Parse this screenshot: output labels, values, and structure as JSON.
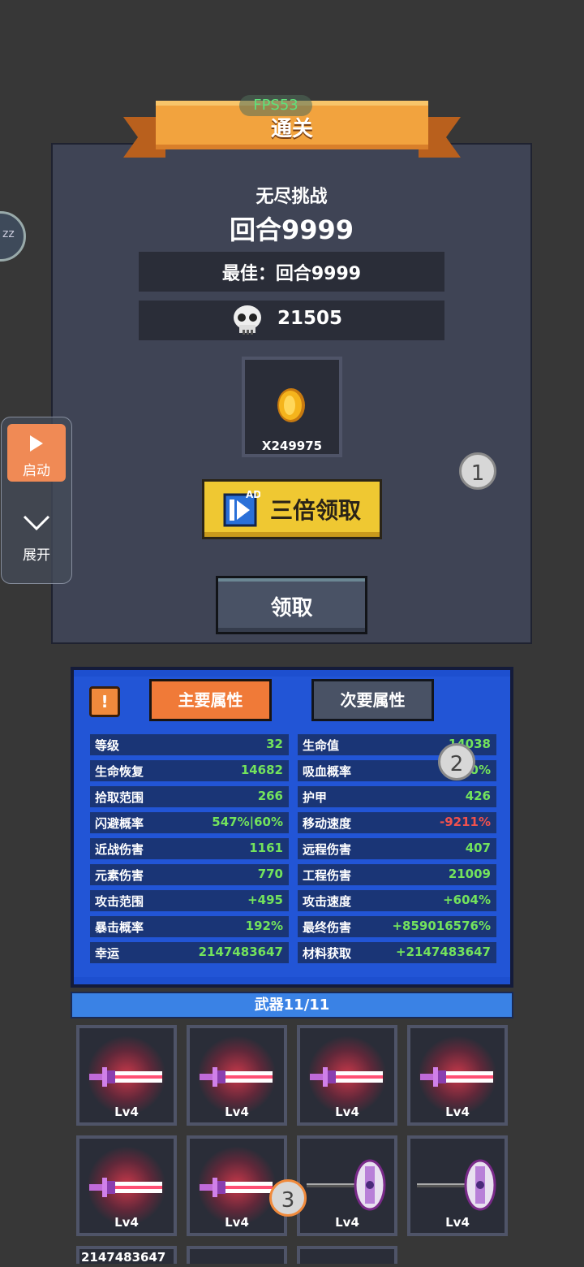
{
  "overlay": {
    "fps": "FPS53",
    "start_label": "启动",
    "expand_label": "展开",
    "zz_label": "zz",
    "markers": [
      "1",
      "2",
      "3"
    ]
  },
  "result": {
    "title": "通关",
    "mode": "无尽挑战",
    "round": "回合9999",
    "best": "最佳：回合9999",
    "kills": "21505",
    "coins": "X249975",
    "triple_button": "三倍领取",
    "ad_badge": "AD",
    "claim_button": "领取"
  },
  "stats": {
    "info_label": "!",
    "tab_main": "主要属性",
    "tab_sub": "次要属性",
    "left": [
      {
        "name": "等级",
        "value": "32",
        "color": "green"
      },
      {
        "name": "生命恢复",
        "value": "14682",
        "color": "green"
      },
      {
        "name": "拾取范围",
        "value": "266",
        "color": "green"
      },
      {
        "name": "闪避概率",
        "value": "547%|60%",
        "color": "green"
      },
      {
        "name": "近战伤害",
        "value": "1161",
        "color": "green"
      },
      {
        "name": "元素伤害",
        "value": "770",
        "color": "green"
      },
      {
        "name": "攻击范围",
        "value": "+495",
        "color": "green"
      },
      {
        "name": "暴击概率",
        "value": "192%",
        "color": "green"
      },
      {
        "name": "幸运",
        "value": "2147483647",
        "color": "green"
      }
    ],
    "right": [
      {
        "name": "生命值",
        "value": "14038",
        "color": "green"
      },
      {
        "name": "吸血概率",
        "value": "290%",
        "color": "green"
      },
      {
        "name": "护甲",
        "value": "426",
        "color": "green"
      },
      {
        "name": "移动速度",
        "value": "-9211%",
        "color": "red"
      },
      {
        "name": "远程伤害",
        "value": "407",
        "color": "green"
      },
      {
        "name": "工程伤害",
        "value": "21009",
        "color": "green"
      },
      {
        "name": "攻击速度",
        "value": "+604%",
        "color": "green"
      },
      {
        "name": "最终伤害",
        "value": "+859016576%",
        "color": "green"
      },
      {
        "name": "材料获取",
        "value": "+2147483647",
        "color": "green"
      }
    ]
  },
  "weapons": {
    "header": "武器11/11",
    "items": [
      {
        "type": "sword-icon",
        "level": "Lv4"
      },
      {
        "type": "sword-icon",
        "level": "Lv4"
      },
      {
        "type": "sword-icon",
        "level": "Lv4"
      },
      {
        "type": "sword-icon",
        "level": "Lv4"
      },
      {
        "type": "sword-icon",
        "level": "Lv4"
      },
      {
        "type": "sword-icon",
        "level": "Lv4"
      },
      {
        "type": "axe-icon",
        "level": "Lv4"
      },
      {
        "type": "axe-icon",
        "level": "Lv4"
      }
    ],
    "bottom_value": "2147483647"
  },
  "colors": {
    "green": "#73e35c",
    "red": "#f0514d",
    "accent": "#f07a38",
    "gold": "#efc832"
  }
}
